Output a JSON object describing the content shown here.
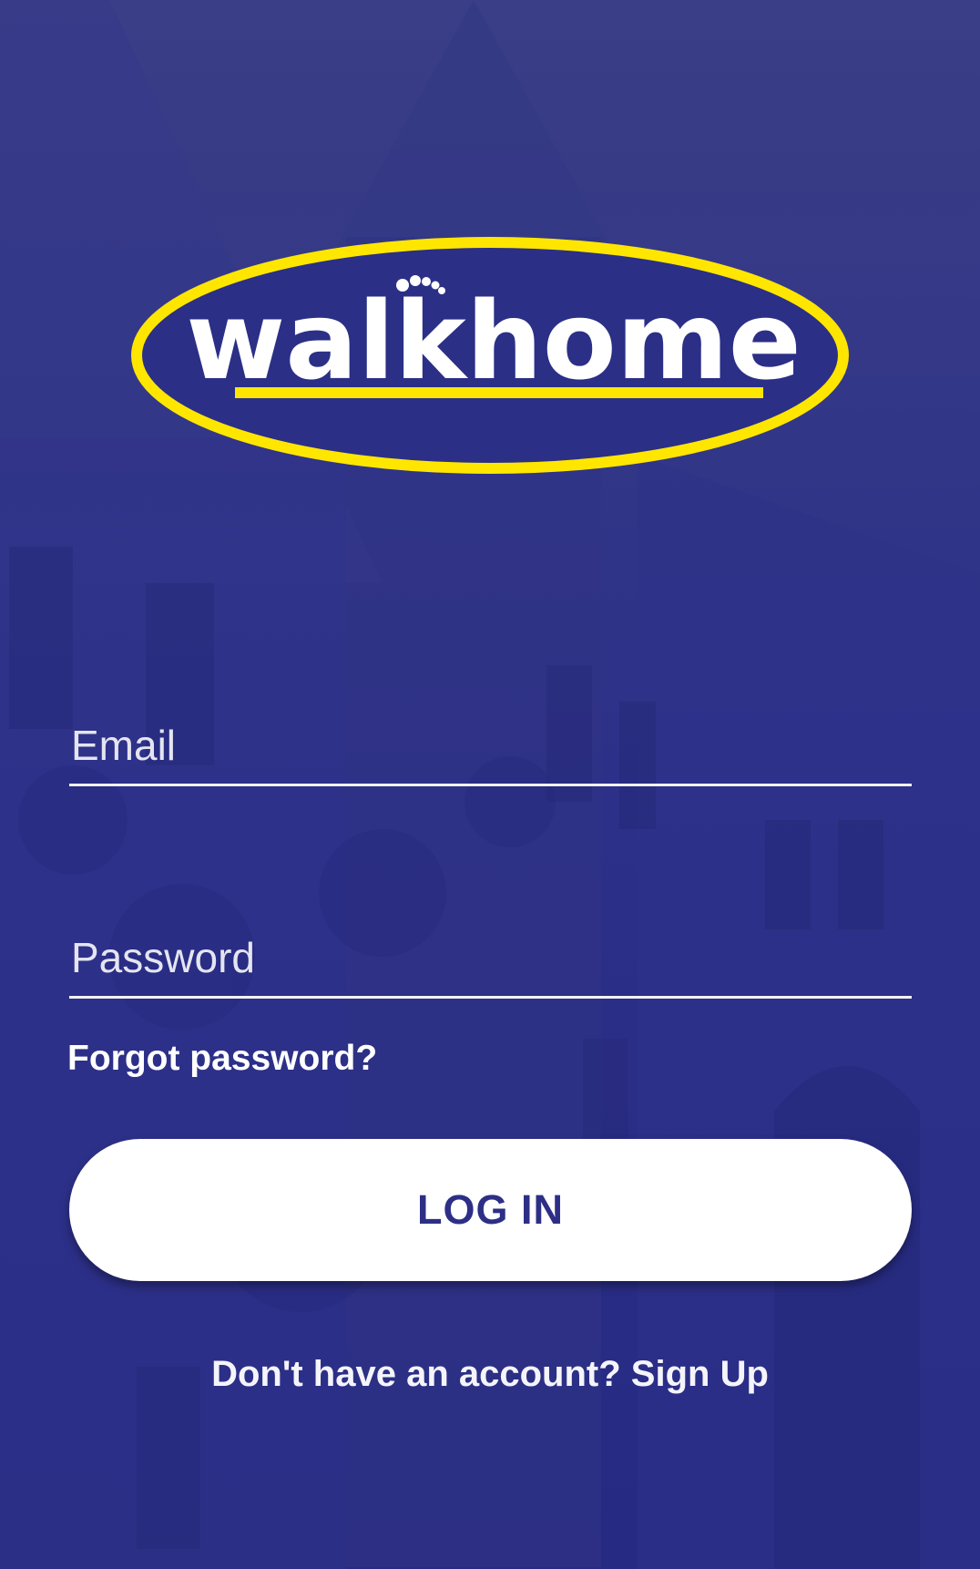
{
  "logo": {
    "text": "walkhome",
    "outline_color": "#ffe600",
    "fill_color": "#2b2f86",
    "icon": "footprint-icon"
  },
  "form": {
    "email_placeholder": "Email",
    "password_placeholder": "Password",
    "forgot_password_label": "Forgot password?",
    "login_label": "LOG IN"
  },
  "signup": {
    "prompt": "Don't have an account?",
    "link_label": "Sign Up"
  },
  "colors": {
    "background": "#2b2f86",
    "accent": "#ffe600",
    "button_text": "#2d2f86",
    "text": "#ffffff"
  }
}
